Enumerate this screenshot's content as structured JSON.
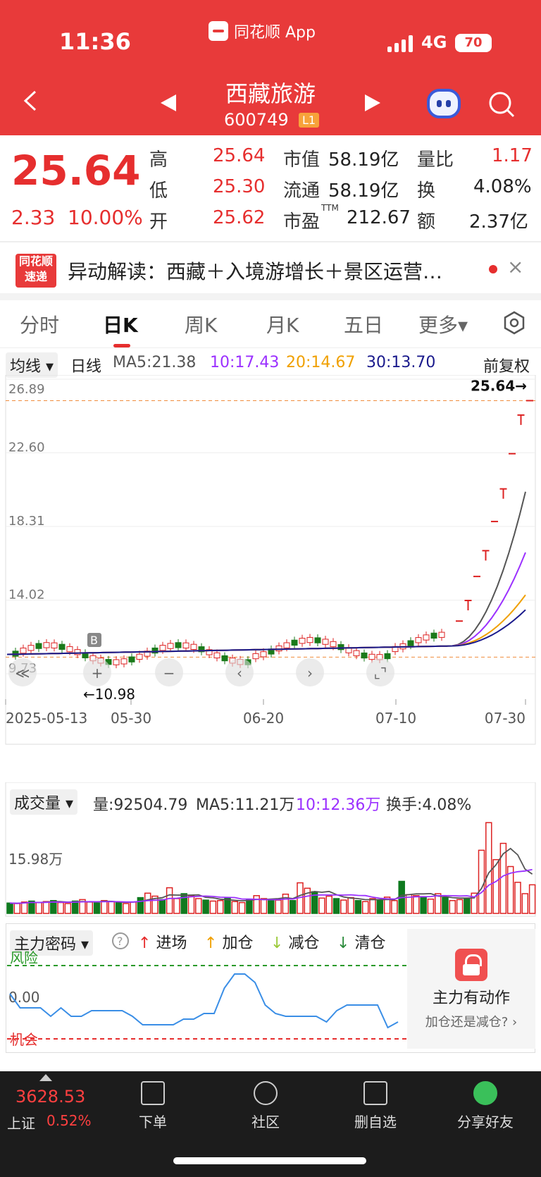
{
  "status": {
    "time": "11:36",
    "app": "同花顺 App",
    "network": "4G",
    "battery": "70"
  },
  "header": {
    "name": "西藏旅游",
    "code": "600749",
    "level": "L1"
  },
  "quote": {
    "price": "25.64",
    "change": "2.33",
    "change_pct": "10.00%",
    "rows": [
      {
        "l1": "高",
        "v1": "25.64",
        "l2": "市值",
        "v2": "58.19亿",
        "l3": "量比",
        "v3": "1.17"
      },
      {
        "l1": "低",
        "v1": "25.30",
        "l2": "流通",
        "v2": "58.19亿",
        "l3": "换",
        "v3": "4.08%"
      },
      {
        "l1": "开",
        "v1": "25.62",
        "l2": "市盈",
        "sup": "TTM",
        "v2": "212.67",
        "l3": "额",
        "v3": "2.37亿"
      }
    ]
  },
  "news": {
    "logo_top": "同花顺",
    "logo_bottom": "速递",
    "text": "异动解读：西藏＋入境游增长＋景区运营…",
    "close": "×"
  },
  "tabs": [
    "分时",
    "日K",
    "周K",
    "月K",
    "五日",
    "更多▾"
  ],
  "ma_row": {
    "dropdown": "均线 ▾",
    "period": "日线",
    "ma5": "MA5:21.38",
    "ma10": "10:17.43",
    "ma20": "20:14.67",
    "ma30": "30:13.70",
    "adjust": "前复权"
  },
  "chart_data": [
    {
      "type": "candlestick",
      "title": "",
      "y_ticks": [
        "26.89",
        "22.60",
        "18.31",
        "14.02",
        "9.73"
      ],
      "ylim": [
        9.73,
        26.89
      ],
      "x_ticks": [
        "2025-05-13",
        "05-30",
        "06-20",
        "07-10",
        "07-30"
      ],
      "price_label": "25.64→",
      "low_label": "←10.98",
      "marker": "B",
      "last_candles": [
        12.8,
        14.0,
        15.4,
        16.9,
        18.6,
        20.5,
        22.55,
        24.8,
        25.64
      ],
      "ma_colors": {
        "ma5": "#555555",
        "ma10": "#9b30ff",
        "ma20": "#f0a000",
        "ma30": "#1a1a8c"
      }
    },
    {
      "type": "bar",
      "title": "成交量",
      "dropdown": "成交量 ▾",
      "stats": {
        "vol": "量:92504.79",
        "ma5": "MA5:11.21万",
        "ma10": "10:12.36万",
        "turnover": "换手:4.08%"
      },
      "y_tick": "15.98万",
      "values": [
        2.1,
        2.0,
        2.3,
        2.5,
        2.2,
        2.4,
        2.6,
        2.2,
        2.0,
        2.5,
        2.8,
        2.3,
        2.1,
        2.6,
        2.4,
        2.2,
        2.0,
        2.3,
        3.2,
        4.1,
        3.5,
        2.8,
        5.2,
        3.0,
        4.0,
        3.6,
        3.0,
        2.7,
        2.5,
        2.6,
        3.1,
        2.4,
        2.2,
        2.9,
        3.6,
        3.0,
        2.8,
        2.7,
        3.9,
        2.6,
        6.2,
        5.1,
        4.4,
        3.1,
        3.5,
        3.0,
        2.7,
        3.2,
        2.6,
        2.4,
        3.0,
        2.8,
        3.3,
        2.6,
        6.5,
        3.8,
        3.6,
        3.3,
        2.9,
        4.0,
        3.2,
        2.6,
        2.8,
        3.0,
        4.1,
        12.8,
        18.4,
        10.9,
        14.2,
        9.5,
        6.3,
        4.0,
        5.8
      ]
    },
    {
      "type": "line",
      "title": "主力密码",
      "dropdown": "主力密码 ▾",
      "legend": [
        "进场",
        "加仓",
        "减仓",
        "清仓"
      ],
      "top_label": "风险",
      "mid_label": "0.00",
      "bottom_label": "机会",
      "values": [
        0.0,
        -0.25,
        -0.25,
        -0.25,
        -0.4,
        -0.25,
        -0.4,
        -0.4,
        -0.3,
        -0.3,
        -0.3,
        -0.3,
        -0.4,
        -0.55,
        -0.55,
        -0.55,
        -0.55,
        -0.45,
        -0.45,
        -0.35,
        -0.35,
        0.1,
        0.35,
        0.35,
        0.2,
        -0.2,
        -0.35,
        -0.4,
        -0.4,
        -0.4,
        -0.4,
        -0.5,
        -0.3,
        -0.2,
        -0.2,
        -0.2,
        -0.2,
        -0.6,
        -0.5
      ]
    }
  ],
  "main_action": {
    "title": "主力有动作",
    "sub": "加仓还是减仓?"
  },
  "bottom_nav": {
    "index_value": "3628.53",
    "index_name": "上证",
    "index_pct": "0.52%",
    "items": [
      "下单",
      "社区",
      "删自选",
      "分享好友"
    ]
  }
}
